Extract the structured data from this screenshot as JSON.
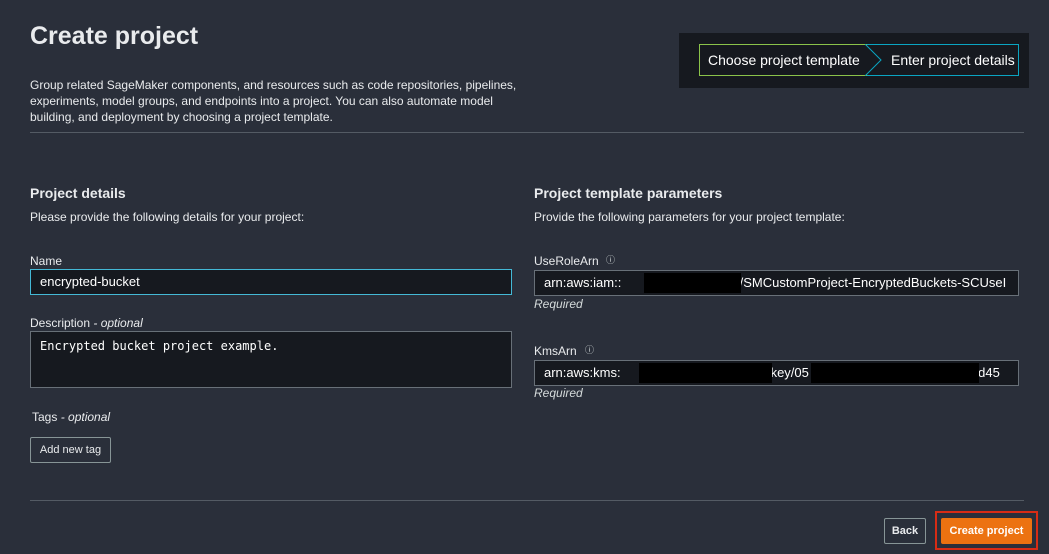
{
  "header": {
    "title": "Create project",
    "description": "Group related SageMaker components, and resources such as code repositories, pipelines, experiments, model groups, and endpoints into a project. You can also automate model building, and deployment by choosing a project template."
  },
  "steps": {
    "step1": "Choose project template",
    "step2": "Enter project details"
  },
  "project_details": {
    "title": "Project details",
    "subtitle": "Please provide the following details for your project:",
    "name_label": "Name",
    "name_value": "encrypted-bucket",
    "description_label": "Description",
    "description_optional": " - optional",
    "description_value": "Encrypted bucket project example.",
    "tags_label": "Tags",
    "tags_optional": " - optional",
    "add_tag_button": "Add new tag"
  },
  "template_params": {
    "title": "Project template parameters",
    "subtitle": "Provide the following parameters for your project template:",
    "role_label": "UseRoleArn",
    "role_value_prefix": "arn:aws:iam::",
    "role_value_suffix": ":role/SMCustomProject-EncryptedBuckets-SCUseI",
    "role_required": "Required",
    "kms_label": "KmsArn",
    "kms_value_prefix": "arn:aws:kms:",
    "kms_value_middle": "key/05",
    "kms_value_suffix": "bd45",
    "kms_required": "Required",
    "info_icon_text": "ⓘ"
  },
  "footer": {
    "back_button": "Back",
    "create_button": "Create project"
  },
  "colors": {
    "background": "#2a2f3a",
    "primary": "#ec7211",
    "highlight": "#d72c15",
    "focus": "#44b9d6"
  }
}
